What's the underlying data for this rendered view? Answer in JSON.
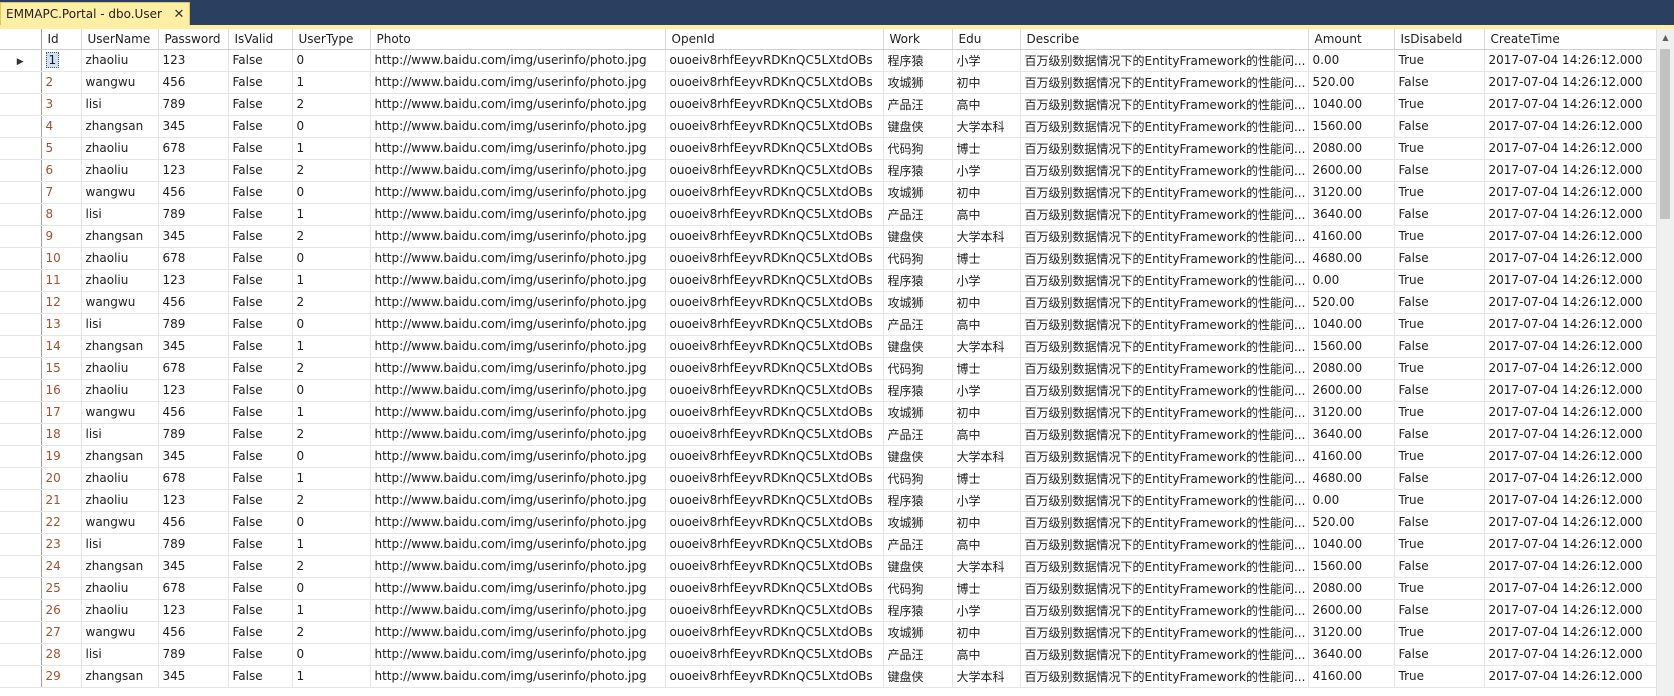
{
  "tab": {
    "title": "EMMAPC.Portal - dbo.User"
  },
  "columns": [
    "Id",
    "UserName",
    "Password",
    "IsValid",
    "UserType",
    "Photo",
    "OpenId",
    "Work",
    "Edu",
    "Describe",
    "Amount",
    "IsDisabeld",
    "CreateTime"
  ],
  "rows": [
    [
      "1",
      "zhaoliu",
      "123",
      "False",
      "0",
      "http://www.baidu.com/img/userinfo/photo.jpg",
      "ouoeiv8rhfEeyvRDKnQC5LXtdOBs",
      "程序猿",
      "小学",
      "百万级别数据情况下的EntityFramework的性能问...",
      "0.00",
      "True",
      "2017-07-04 14:26:12.000"
    ],
    [
      "2",
      "wangwu",
      "456",
      "False",
      "1",
      "http://www.baidu.com/img/userinfo/photo.jpg",
      "ouoeiv8rhfEeyvRDKnQC5LXtdOBs",
      "攻城狮",
      "初中",
      "百万级别数据情况下的EntityFramework的性能问...",
      "520.00",
      "False",
      "2017-07-04 14:26:12.000"
    ],
    [
      "3",
      "lisi",
      "789",
      "False",
      "2",
      "http://www.baidu.com/img/userinfo/photo.jpg",
      "ouoeiv8rhfEeyvRDKnQC5LXtdOBs",
      "产品汪",
      "高中",
      "百万级别数据情况下的EntityFramework的性能问...",
      "1040.00",
      "True",
      "2017-07-04 14:26:12.000"
    ],
    [
      "4",
      "zhangsan",
      "345",
      "False",
      "0",
      "http://www.baidu.com/img/userinfo/photo.jpg",
      "ouoeiv8rhfEeyvRDKnQC5LXtdOBs",
      "键盘侠",
      "大学本科",
      "百万级别数据情况下的EntityFramework的性能问...",
      "1560.00",
      "False",
      "2017-07-04 14:26:12.000"
    ],
    [
      "5",
      "zhaoliu",
      "678",
      "False",
      "1",
      "http://www.baidu.com/img/userinfo/photo.jpg",
      "ouoeiv8rhfEeyvRDKnQC5LXtdOBs",
      "代码狗",
      "博士",
      "百万级别数据情况下的EntityFramework的性能问...",
      "2080.00",
      "True",
      "2017-07-04 14:26:12.000"
    ],
    [
      "6",
      "zhaoliu",
      "123",
      "False",
      "2",
      "http://www.baidu.com/img/userinfo/photo.jpg",
      "ouoeiv8rhfEeyvRDKnQC5LXtdOBs",
      "程序猿",
      "小学",
      "百万级别数据情况下的EntityFramework的性能问...",
      "2600.00",
      "False",
      "2017-07-04 14:26:12.000"
    ],
    [
      "7",
      "wangwu",
      "456",
      "False",
      "0",
      "http://www.baidu.com/img/userinfo/photo.jpg",
      "ouoeiv8rhfEeyvRDKnQC5LXtdOBs",
      "攻城狮",
      "初中",
      "百万级别数据情况下的EntityFramework的性能问...",
      "3120.00",
      "True",
      "2017-07-04 14:26:12.000"
    ],
    [
      "8",
      "lisi",
      "789",
      "False",
      "1",
      "http://www.baidu.com/img/userinfo/photo.jpg",
      "ouoeiv8rhfEeyvRDKnQC5LXtdOBs",
      "产品汪",
      "高中",
      "百万级别数据情况下的EntityFramework的性能问...",
      "3640.00",
      "False",
      "2017-07-04 14:26:12.000"
    ],
    [
      "9",
      "zhangsan",
      "345",
      "False",
      "2",
      "http://www.baidu.com/img/userinfo/photo.jpg",
      "ouoeiv8rhfEeyvRDKnQC5LXtdOBs",
      "键盘侠",
      "大学本科",
      "百万级别数据情况下的EntityFramework的性能问...",
      "4160.00",
      "True",
      "2017-07-04 14:26:12.000"
    ],
    [
      "10",
      "zhaoliu",
      "678",
      "False",
      "0",
      "http://www.baidu.com/img/userinfo/photo.jpg",
      "ouoeiv8rhfEeyvRDKnQC5LXtdOBs",
      "代码狗",
      "博士",
      "百万级别数据情况下的EntityFramework的性能问...",
      "4680.00",
      "False",
      "2017-07-04 14:26:12.000"
    ],
    [
      "11",
      "zhaoliu",
      "123",
      "False",
      "1",
      "http://www.baidu.com/img/userinfo/photo.jpg",
      "ouoeiv8rhfEeyvRDKnQC5LXtdOBs",
      "程序猿",
      "小学",
      "百万级别数据情况下的EntityFramework的性能问...",
      "0.00",
      "True",
      "2017-07-04 14:26:12.000"
    ],
    [
      "12",
      "wangwu",
      "456",
      "False",
      "2",
      "http://www.baidu.com/img/userinfo/photo.jpg",
      "ouoeiv8rhfEeyvRDKnQC5LXtdOBs",
      "攻城狮",
      "初中",
      "百万级别数据情况下的EntityFramework的性能问...",
      "520.00",
      "False",
      "2017-07-04 14:26:12.000"
    ],
    [
      "13",
      "lisi",
      "789",
      "False",
      "0",
      "http://www.baidu.com/img/userinfo/photo.jpg",
      "ouoeiv8rhfEeyvRDKnQC5LXtdOBs",
      "产品汪",
      "高中",
      "百万级别数据情况下的EntityFramework的性能问...",
      "1040.00",
      "True",
      "2017-07-04 14:26:12.000"
    ],
    [
      "14",
      "zhangsan",
      "345",
      "False",
      "1",
      "http://www.baidu.com/img/userinfo/photo.jpg",
      "ouoeiv8rhfEeyvRDKnQC5LXtdOBs",
      "键盘侠",
      "大学本科",
      "百万级别数据情况下的EntityFramework的性能问...",
      "1560.00",
      "False",
      "2017-07-04 14:26:12.000"
    ],
    [
      "15",
      "zhaoliu",
      "678",
      "False",
      "2",
      "http://www.baidu.com/img/userinfo/photo.jpg",
      "ouoeiv8rhfEeyvRDKnQC5LXtdOBs",
      "代码狗",
      "博士",
      "百万级别数据情况下的EntityFramework的性能问...",
      "2080.00",
      "True",
      "2017-07-04 14:26:12.000"
    ],
    [
      "16",
      "zhaoliu",
      "123",
      "False",
      "0",
      "http://www.baidu.com/img/userinfo/photo.jpg",
      "ouoeiv8rhfEeyvRDKnQC5LXtdOBs",
      "程序猿",
      "小学",
      "百万级别数据情况下的EntityFramework的性能问...",
      "2600.00",
      "False",
      "2017-07-04 14:26:12.000"
    ],
    [
      "17",
      "wangwu",
      "456",
      "False",
      "1",
      "http://www.baidu.com/img/userinfo/photo.jpg",
      "ouoeiv8rhfEeyvRDKnQC5LXtdOBs",
      "攻城狮",
      "初中",
      "百万级别数据情况下的EntityFramework的性能问...",
      "3120.00",
      "True",
      "2017-07-04 14:26:12.000"
    ],
    [
      "18",
      "lisi",
      "789",
      "False",
      "2",
      "http://www.baidu.com/img/userinfo/photo.jpg",
      "ouoeiv8rhfEeyvRDKnQC5LXtdOBs",
      "产品汪",
      "高中",
      "百万级别数据情况下的EntityFramework的性能问...",
      "3640.00",
      "False",
      "2017-07-04 14:26:12.000"
    ],
    [
      "19",
      "zhangsan",
      "345",
      "False",
      "0",
      "http://www.baidu.com/img/userinfo/photo.jpg",
      "ouoeiv8rhfEeyvRDKnQC5LXtdOBs",
      "键盘侠",
      "大学本科",
      "百万级别数据情况下的EntityFramework的性能问...",
      "4160.00",
      "True",
      "2017-07-04 14:26:12.000"
    ],
    [
      "20",
      "zhaoliu",
      "678",
      "False",
      "1",
      "http://www.baidu.com/img/userinfo/photo.jpg",
      "ouoeiv8rhfEeyvRDKnQC5LXtdOBs",
      "代码狗",
      "博士",
      "百万级别数据情况下的EntityFramework的性能问...",
      "4680.00",
      "False",
      "2017-07-04 14:26:12.000"
    ],
    [
      "21",
      "zhaoliu",
      "123",
      "False",
      "2",
      "http://www.baidu.com/img/userinfo/photo.jpg",
      "ouoeiv8rhfEeyvRDKnQC5LXtdOBs",
      "程序猿",
      "小学",
      "百万级别数据情况下的EntityFramework的性能问...",
      "0.00",
      "True",
      "2017-07-04 14:26:12.000"
    ],
    [
      "22",
      "wangwu",
      "456",
      "False",
      "0",
      "http://www.baidu.com/img/userinfo/photo.jpg",
      "ouoeiv8rhfEeyvRDKnQC5LXtdOBs",
      "攻城狮",
      "初中",
      "百万级别数据情况下的EntityFramework的性能问...",
      "520.00",
      "False",
      "2017-07-04 14:26:12.000"
    ],
    [
      "23",
      "lisi",
      "789",
      "False",
      "1",
      "http://www.baidu.com/img/userinfo/photo.jpg",
      "ouoeiv8rhfEeyvRDKnQC5LXtdOBs",
      "产品汪",
      "高中",
      "百万级别数据情况下的EntityFramework的性能问...",
      "1040.00",
      "True",
      "2017-07-04 14:26:12.000"
    ],
    [
      "24",
      "zhangsan",
      "345",
      "False",
      "2",
      "http://www.baidu.com/img/userinfo/photo.jpg",
      "ouoeiv8rhfEeyvRDKnQC5LXtdOBs",
      "键盘侠",
      "大学本科",
      "百万级别数据情况下的EntityFramework的性能问...",
      "1560.00",
      "False",
      "2017-07-04 14:26:12.000"
    ],
    [
      "25",
      "zhaoliu",
      "678",
      "False",
      "0",
      "http://www.baidu.com/img/userinfo/photo.jpg",
      "ouoeiv8rhfEeyvRDKnQC5LXtdOBs",
      "代码狗",
      "博士",
      "百万级别数据情况下的EntityFramework的性能问...",
      "2080.00",
      "True",
      "2017-07-04 14:26:12.000"
    ],
    [
      "26",
      "zhaoliu",
      "123",
      "False",
      "1",
      "http://www.baidu.com/img/userinfo/photo.jpg",
      "ouoeiv8rhfEeyvRDKnQC5LXtdOBs",
      "程序猿",
      "小学",
      "百万级别数据情况下的EntityFramework的性能问...",
      "2600.00",
      "False",
      "2017-07-04 14:26:12.000"
    ],
    [
      "27",
      "wangwu",
      "456",
      "False",
      "2",
      "http://www.baidu.com/img/userinfo/photo.jpg",
      "ouoeiv8rhfEeyvRDKnQC5LXtdOBs",
      "攻城狮",
      "初中",
      "百万级别数据情况下的EntityFramework的性能问...",
      "3120.00",
      "True",
      "2017-07-04 14:26:12.000"
    ],
    [
      "28",
      "lisi",
      "789",
      "False",
      "0",
      "http://www.baidu.com/img/userinfo/photo.jpg",
      "ouoeiv8rhfEeyvRDKnQC5LXtdOBs",
      "产品汪",
      "高中",
      "百万级别数据情况下的EntityFramework的性能问...",
      "3640.00",
      "False",
      "2017-07-04 14:26:12.000"
    ],
    [
      "29",
      "zhangsan",
      "345",
      "False",
      "1",
      "http://www.baidu.com/img/userinfo/photo.jpg",
      "ouoeiv8rhfEeyvRDKnQC5LXtdOBs",
      "键盘侠",
      "大学本科",
      "百万级别数据情况下的EntityFramework的性能问...",
      "4160.00",
      "True",
      "2017-07-04 14:26:12.000"
    ]
  ],
  "selected_row": "1",
  "icons": {
    "close": "close-icon",
    "current_row": "row-pointer-icon",
    "scroll_up": "scroll-up-icon"
  }
}
